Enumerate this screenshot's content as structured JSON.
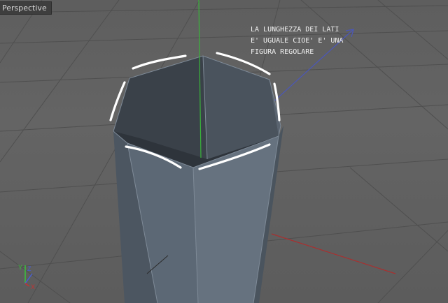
{
  "viewport": {
    "view_name": "Perspective"
  },
  "annotation": {
    "lines": [
      "LA LUNGHEZZA DEI LATI",
      "E' UGUALE CIOE' E' UNA",
      "FIGURA REGOLARE"
    ]
  },
  "axes_gizmo": {
    "y_label": "Y",
    "z_label": "Z",
    "x_label": "X",
    "y_color": "#39c43a",
    "z_color": "#4a5fd0",
    "x_color": "#c83030"
  },
  "colors": {
    "grid_line": "#4e4e4e",
    "prism_face_dark": "#2c3238",
    "prism_face_mid": "#5a6571",
    "prism_face_light": "#6b7785",
    "highlight_stroke": "#ffffff"
  }
}
